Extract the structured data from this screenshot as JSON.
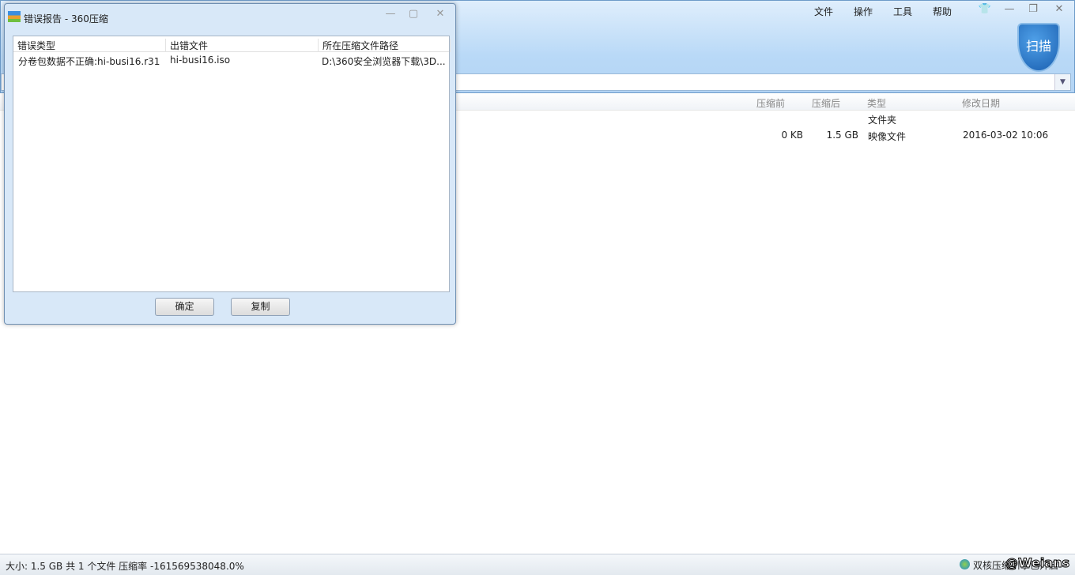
{
  "main": {
    "menu": [
      "文件",
      "操作",
      "工具",
      "帮助"
    ],
    "scan_label": "扫描",
    "columns": [
      "压缩前",
      "压缩后",
      "类型",
      "修改日期"
    ],
    "rows": [
      {
        "before": "",
        "after": "",
        "type": "文件夹",
        "date": ""
      },
      {
        "before": "0 KB",
        "after": "1.5 GB",
        "type": "映像文件",
        "date": "2016-03-02 10:06"
      }
    ],
    "status": "大小: 1.5 GB 共 1 个文件 压缩率 -161569538048.0%",
    "engine": "双核压缩引擎已开启",
    "watermark": "@Weians"
  },
  "dialog": {
    "title": "错误报告 - 360压缩",
    "columns": [
      "错误类型",
      "出错文件",
      "所在压缩文件路径"
    ],
    "rows": [
      {
        "error": "分卷包数据不正确:hi-busi16.r31",
        "file": "hi-busi16.iso",
        "path": "D:\\360安全浏览器下载\\3D..."
      }
    ],
    "ok": "确定",
    "copy": "复制"
  }
}
